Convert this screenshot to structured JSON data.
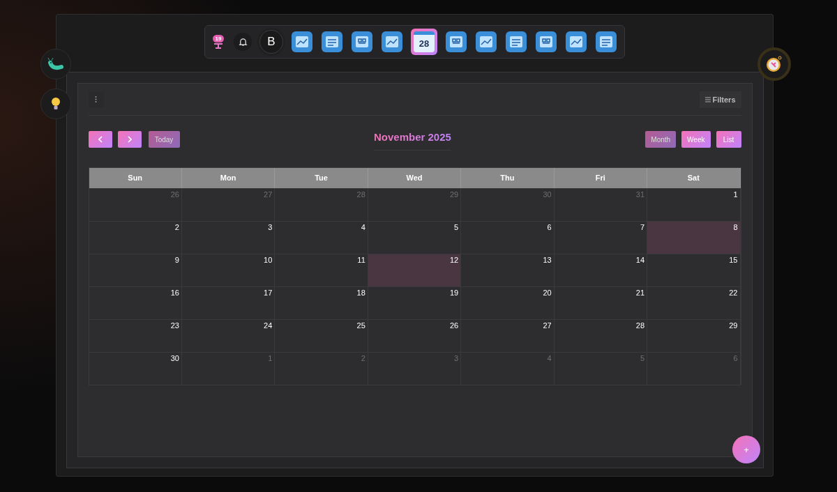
{
  "dock": {
    "badge": "19",
    "avatar": "B",
    "apps": [
      {
        "selected": false
      },
      {
        "selected": false
      },
      {
        "selected": false
      },
      {
        "selected": false
      },
      {
        "selected": true,
        "text": "28"
      },
      {
        "selected": false
      },
      {
        "selected": false
      },
      {
        "selected": false
      },
      {
        "selected": false
      },
      {
        "selected": false
      },
      {
        "selected": false
      }
    ]
  },
  "toolbar": {
    "filters": "Filters"
  },
  "calendar": {
    "title": "November 2025",
    "today": "Today",
    "today_disabled": true,
    "views": [
      {
        "label": "Month",
        "selected": true
      },
      {
        "label": "Week",
        "selected": false
      },
      {
        "label": "List",
        "selected": false
      }
    ],
    "weekdays": [
      "Sun",
      "Mon",
      "Tue",
      "Wed",
      "Thu",
      "Fri",
      "Sat"
    ],
    "weeks": [
      [
        {
          "day": "26",
          "outside": true,
          "highlighted": false
        },
        {
          "day": "27",
          "outside": true,
          "highlighted": false
        },
        {
          "day": "28",
          "outside": true,
          "highlighted": false
        },
        {
          "day": "29",
          "outside": true,
          "highlighted": false
        },
        {
          "day": "30",
          "outside": true,
          "highlighted": false
        },
        {
          "day": "31",
          "outside": true,
          "highlighted": false
        },
        {
          "day": "1",
          "outside": false,
          "highlighted": false
        }
      ],
      [
        {
          "day": "2",
          "outside": false,
          "highlighted": false
        },
        {
          "day": "3",
          "outside": false,
          "highlighted": false
        },
        {
          "day": "4",
          "outside": false,
          "highlighted": false
        },
        {
          "day": "5",
          "outside": false,
          "highlighted": false
        },
        {
          "day": "6",
          "outside": false,
          "highlighted": false
        },
        {
          "day": "7",
          "outside": false,
          "highlighted": false
        },
        {
          "day": "8",
          "outside": false,
          "highlighted": true
        }
      ],
      [
        {
          "day": "9",
          "outside": false,
          "highlighted": false
        },
        {
          "day": "10",
          "outside": false,
          "highlighted": false
        },
        {
          "day": "11",
          "outside": false,
          "highlighted": false
        },
        {
          "day": "12",
          "outside": false,
          "highlighted": true
        },
        {
          "day": "13",
          "outside": false,
          "highlighted": false
        },
        {
          "day": "14",
          "outside": false,
          "highlighted": false
        },
        {
          "day": "15",
          "outside": false,
          "highlighted": false
        }
      ],
      [
        {
          "day": "16",
          "outside": false,
          "highlighted": false
        },
        {
          "day": "17",
          "outside": false,
          "highlighted": false
        },
        {
          "day": "18",
          "outside": false,
          "highlighted": false
        },
        {
          "day": "19",
          "outside": false,
          "highlighted": false
        },
        {
          "day": "20",
          "outside": false,
          "highlighted": false
        },
        {
          "day": "21",
          "outside": false,
          "highlighted": false
        },
        {
          "day": "22",
          "outside": false,
          "highlighted": false
        }
      ],
      [
        {
          "day": "23",
          "outside": false,
          "highlighted": false
        },
        {
          "day": "24",
          "outside": false,
          "highlighted": false
        },
        {
          "day": "25",
          "outside": false,
          "highlighted": false
        },
        {
          "day": "26",
          "outside": false,
          "highlighted": false
        },
        {
          "day": "27",
          "outside": false,
          "highlighted": false
        },
        {
          "day": "28",
          "outside": false,
          "highlighted": false
        },
        {
          "day": "29",
          "outside": false,
          "highlighted": false
        }
      ],
      [
        {
          "day": "30",
          "outside": false,
          "highlighted": false
        },
        {
          "day": "1",
          "outside": true,
          "highlighted": false
        },
        {
          "day": "2",
          "outside": true,
          "highlighted": false
        },
        {
          "day": "3",
          "outside": true,
          "highlighted": false
        },
        {
          "day": "4",
          "outside": true,
          "highlighted": false
        },
        {
          "day": "5",
          "outside": true,
          "highlighted": false
        },
        {
          "day": "6",
          "outside": true,
          "highlighted": false
        }
      ]
    ]
  },
  "fab": "+"
}
